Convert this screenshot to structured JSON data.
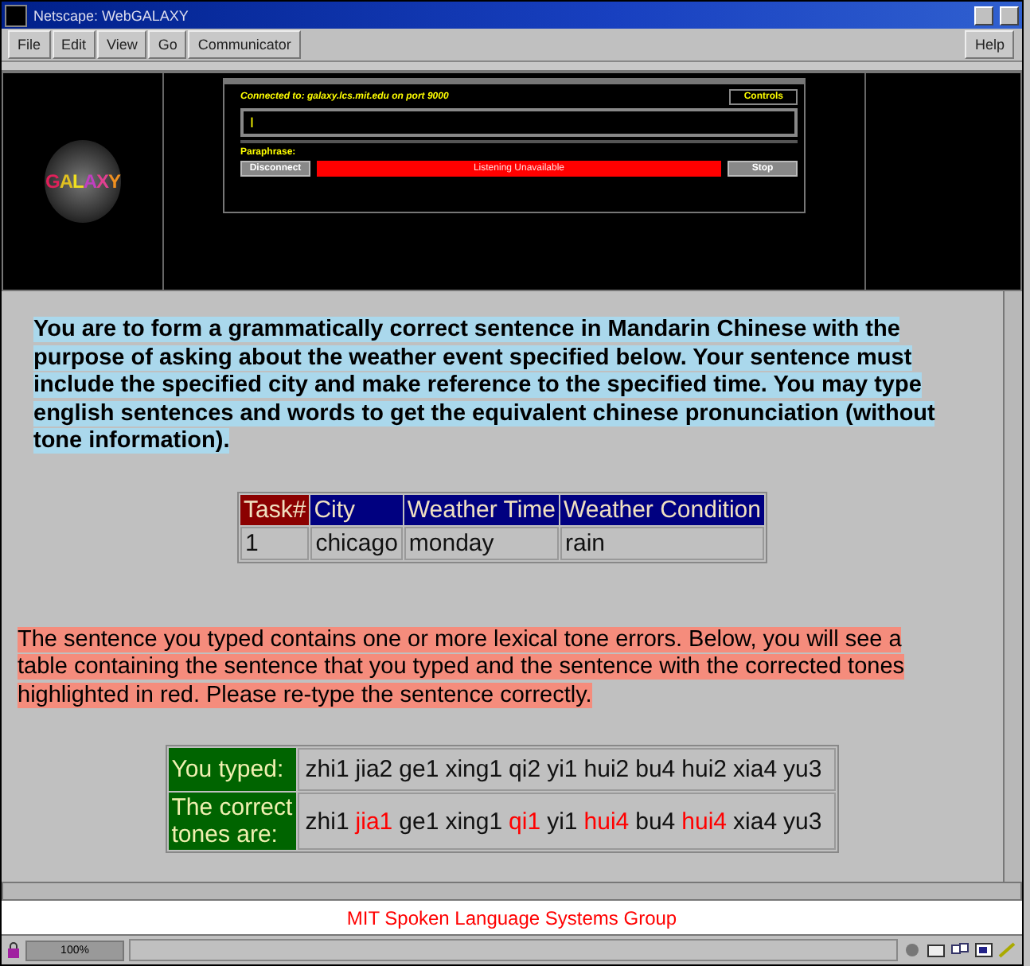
{
  "window": {
    "title": "Netscape: WebGALAXY"
  },
  "menu": [
    {
      "label": "File"
    },
    {
      "label": "Edit"
    },
    {
      "label": "View"
    },
    {
      "label": "Go"
    },
    {
      "label": "Communicator"
    }
  ],
  "help_menu": {
    "label": "Help"
  },
  "banner": {
    "logo": [
      {
        "letter": "G",
        "color": "#e0205a"
      },
      {
        "letter": "A",
        "color": "#e0c020"
      },
      {
        "letter": "L",
        "color": "#f0e020"
      },
      {
        "letter": "A",
        "color": "#c040c0"
      },
      {
        "letter": "X",
        "color": "#e04090"
      },
      {
        "letter": "Y",
        "color": "#f09020"
      }
    ],
    "status": "Connected to: galaxy.lcs.mit.edu on port 9000",
    "controls_button": "Controls",
    "input_value": "I",
    "paraphrase_label": "Paraphrase:",
    "disconnect_button": "Disconnect",
    "listening_status": "Listening Unavailable",
    "stop_button": "Stop"
  },
  "instructions": "You are to form a grammatically correct sentence in Mandarin Chinese with the purpose of asking about the weather event specified below. Your sentence must include the specified city and make reference to the specified time. You may type english sentences and words to get the equivalent chinese pronunciation (without tone information).",
  "task_table": {
    "columns": [
      "Task#",
      "City",
      "Weather Time",
      "Weather Condition"
    ],
    "rows": [
      [
        "1",
        "chicago",
        "monday",
        "rain"
      ]
    ]
  },
  "error_message": "The sentence you typed contains one or more lexical tone errors. Below, you will see a table containing the sentence that you typed and the sentence with the corrected tones highlighted in red. Please re-type the sentence correctly.",
  "tone_table": {
    "rows": [
      {
        "label": "You typed:",
        "words": [
          {
            "text": "zhi1",
            "corrected": false
          },
          {
            "text": "jia2",
            "corrected": false
          },
          {
            "text": "ge1",
            "corrected": false
          },
          {
            "text": "xing1",
            "corrected": false
          },
          {
            "text": "qi2",
            "corrected": false
          },
          {
            "text": "yi1",
            "corrected": false
          },
          {
            "text": "hui2",
            "corrected": false
          },
          {
            "text": "bu4",
            "corrected": false
          },
          {
            "text": "hui2",
            "corrected": false
          },
          {
            "text": "xia4",
            "corrected": false
          },
          {
            "text": "yu3",
            "corrected": false
          }
        ]
      },
      {
        "label": "The correct tones are:",
        "words": [
          {
            "text": "zhi1",
            "corrected": false
          },
          {
            "text": "jia1",
            "corrected": true
          },
          {
            "text": "ge1",
            "corrected": false
          },
          {
            "text": "xing1",
            "corrected": false
          },
          {
            "text": "qi1",
            "corrected": true
          },
          {
            "text": "yi1",
            "corrected": false
          },
          {
            "text": "hui4",
            "corrected": true
          },
          {
            "text": "bu4",
            "corrected": false
          },
          {
            "text": "hui4",
            "corrected": true
          },
          {
            "text": "xia4",
            "corrected": false
          },
          {
            "text": "yu3",
            "corrected": false
          }
        ]
      }
    ]
  },
  "footer": "MIT Spoken Language Systems Group",
  "status_bar": {
    "zoom": "100%"
  }
}
